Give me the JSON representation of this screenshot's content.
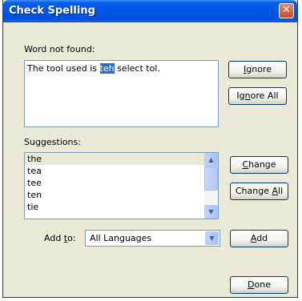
{
  "window": {
    "title": "Check Spelling",
    "close_glyph": "✕"
  },
  "word_not_found": {
    "label": "Word not found:",
    "text_before": "The tool used is ",
    "misspelled": "teh",
    "text_after": " select tol."
  },
  "buttons": {
    "ignore": {
      "accel": "I",
      "rest": "gnore"
    },
    "ignore_all": {
      "pre": "Ig",
      "accel": "n",
      "rest": "ore All"
    },
    "change": {
      "accel": "C",
      "rest": "hange"
    },
    "change_all": {
      "pre": "Change ",
      "accel": "A",
      "rest": "ll"
    },
    "add": {
      "accel": "A",
      "rest": "dd"
    },
    "done": {
      "accel": "D",
      "rest": "one"
    }
  },
  "suggestions": {
    "label": "Suggestions:",
    "items": [
      "the",
      "tea",
      "tee",
      "ten",
      "tie"
    ],
    "selected_index": 0
  },
  "add_to": {
    "label_pre": "Add ",
    "label_accel": "t",
    "label_rest": "o:",
    "selected": "All Languages"
  },
  "icons": {
    "scroll_up": "▲",
    "scroll_down": "▼",
    "combo_arrow": "▼"
  },
  "colors": {
    "titlebar": "#0055e5",
    "dialog_bg": "#ece9d8",
    "highlight": "#316ac5"
  }
}
